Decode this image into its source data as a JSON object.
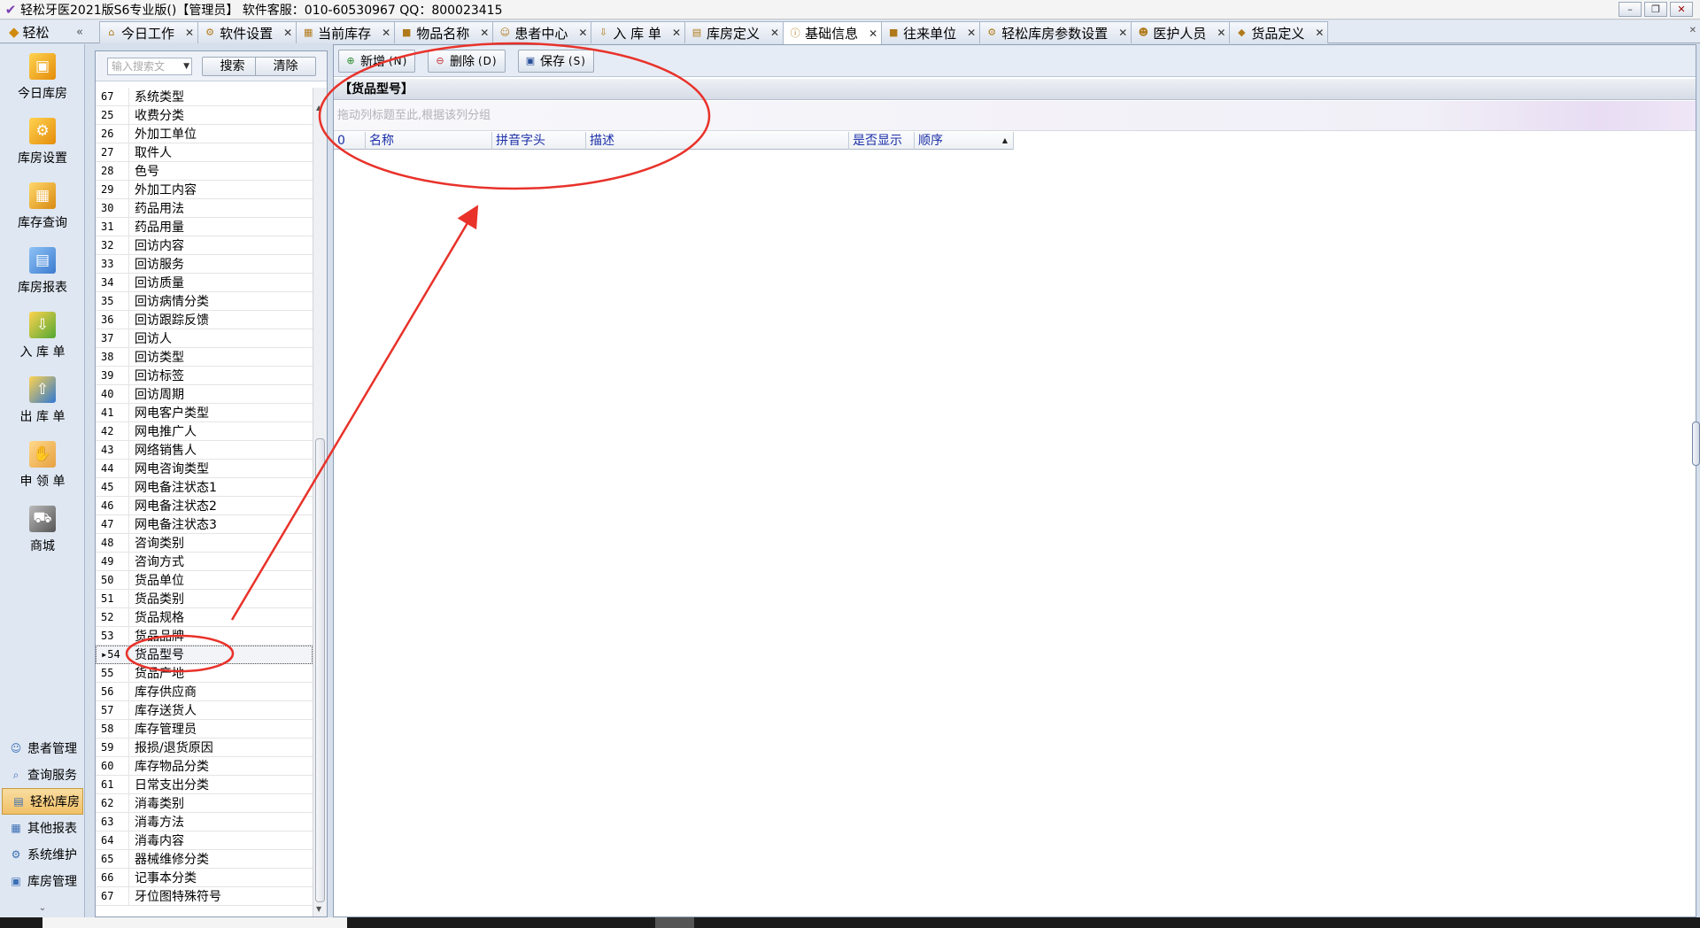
{
  "window": {
    "title": "轻松牙医2021版S6专业版()【管理员】    软件客服：010-60530967 QQ：800023415",
    "buttons": {
      "minimize": "–",
      "restore": "❐",
      "close": "✕"
    }
  },
  "nav_header": {
    "label": "轻松",
    "collapse": "«"
  },
  "tabs": [
    {
      "label": "今日工作",
      "icon": "home-icon"
    },
    {
      "label": "软件设置",
      "icon": "gear-icon"
    },
    {
      "label": "当前库存",
      "icon": "table-icon"
    },
    {
      "label": "物品名称",
      "icon": "box-icon"
    },
    {
      "label": "患者中心",
      "icon": "user-icon"
    },
    {
      "label": "入 库 单",
      "icon": "in-stock-icon"
    },
    {
      "label": "库房定义",
      "icon": "warehouse-icon"
    },
    {
      "label": "基础信息",
      "icon": "info-icon",
      "active": true
    },
    {
      "label": "往来单位",
      "icon": "box-icon"
    },
    {
      "label": "轻松库房参数设置",
      "icon": "gear-icon"
    },
    {
      "label": "医护人员",
      "icon": "staff-icon"
    },
    {
      "label": "货品定义",
      "icon": "tag-icon"
    }
  ],
  "tab_close": "✕",
  "left_nav": {
    "big_items": [
      {
        "label": "今日库房",
        "icon": "warehouse-icon"
      },
      {
        "label": "库房设置",
        "icon": "warehouse-settings-icon"
      },
      {
        "label": "库存查询",
        "icon": "stock-query-icon"
      },
      {
        "label": "库房报表",
        "icon": "report-icon"
      },
      {
        "label": "入 库 单",
        "icon": "stock-in-icon"
      },
      {
        "label": "出 库 单",
        "icon": "stock-out-icon"
      },
      {
        "label": "申 领 单",
        "icon": "request-hand-icon"
      },
      {
        "label": "商城",
        "icon": "cart-icon"
      }
    ],
    "small_items": [
      {
        "label": "患者管理",
        "icon": "patients-icon"
      },
      {
        "label": "查询服务",
        "icon": "query-icon"
      },
      {
        "label": "轻松库房",
        "icon": "warehouse-icon",
        "active": true
      },
      {
        "label": "其他报表",
        "icon": "report-icon"
      },
      {
        "label": "系统维护",
        "icon": "maintenance-icon"
      },
      {
        "label": "库房管理",
        "icon": "warehouse-manage-icon"
      }
    ],
    "more": "⌄"
  },
  "list_panel": {
    "search_placeholder": "输入搜索文",
    "search_button": "搜索",
    "clear_button": "清除",
    "selected_index": 54,
    "rows": [
      {
        "num": "67",
        "name": "系统类型"
      },
      {
        "num": "25",
        "name": "收费分类"
      },
      {
        "num": "26",
        "name": "外加工单位"
      },
      {
        "num": "27",
        "name": "取件人"
      },
      {
        "num": "28",
        "name": "色号"
      },
      {
        "num": "29",
        "name": "外加工内容"
      },
      {
        "num": "30",
        "name": "药品用法"
      },
      {
        "num": "31",
        "name": "药品用量"
      },
      {
        "num": "32",
        "name": "回访内容"
      },
      {
        "num": "33",
        "name": "回访服务"
      },
      {
        "num": "34",
        "name": "回访质量"
      },
      {
        "num": "35",
        "name": "回访病情分类"
      },
      {
        "num": "36",
        "name": "回访跟踪反馈"
      },
      {
        "num": "37",
        "name": "回访人"
      },
      {
        "num": "38",
        "name": "回访类型"
      },
      {
        "num": "39",
        "name": "回访标签"
      },
      {
        "num": "40",
        "name": "回访周期"
      },
      {
        "num": "41",
        "name": "网电客户类型"
      },
      {
        "num": "42",
        "name": "网电推广人"
      },
      {
        "num": "43",
        "name": "网络销售人"
      },
      {
        "num": "44",
        "name": "网电咨询类型"
      },
      {
        "num": "45",
        "name": "网电备注状态1"
      },
      {
        "num": "46",
        "name": "网电备注状态2"
      },
      {
        "num": "47",
        "name": "网电备注状态3"
      },
      {
        "num": "48",
        "name": "咨询类别"
      },
      {
        "num": "49",
        "name": "咨询方式"
      },
      {
        "num": "50",
        "name": "货品单位"
      },
      {
        "num": "51",
        "name": "货品类别"
      },
      {
        "num": "52",
        "name": "货品规格"
      },
      {
        "num": "53",
        "name": "货品品牌"
      },
      {
        "num": "54",
        "name": "货品型号"
      },
      {
        "num": "55",
        "name": "货品产地"
      },
      {
        "num": "56",
        "name": "库存供应商"
      },
      {
        "num": "57",
        "name": "库存送货人"
      },
      {
        "num": "58",
        "name": "库存管理员"
      },
      {
        "num": "59",
        "name": "报损/退货原因"
      },
      {
        "num": "60",
        "name": "库存物品分类"
      },
      {
        "num": "61",
        "name": "日常支出分类"
      },
      {
        "num": "62",
        "name": "消毒类别"
      },
      {
        "num": "63",
        "name": "消毒方法"
      },
      {
        "num": "64",
        "name": "消毒内容"
      },
      {
        "num": "65",
        "name": "器械维修分类"
      },
      {
        "num": "66",
        "name": "记事本分类"
      },
      {
        "num": "67",
        "name": "牙位图特殊符号"
      }
    ]
  },
  "toolbar": {
    "add_label": "新增",
    "add_shortcut": "(N)",
    "delete_label": "删除",
    "delete_shortcut": "(D)",
    "save_label": "保存",
    "save_shortcut": "(S)"
  },
  "detail": {
    "panel_title": "【货品型号】",
    "group_hint": "拖动列标题至此,根据该列分组",
    "columns": [
      "0",
      "名称",
      "拼音字头",
      "描述",
      "是否显示",
      "顺序"
    ],
    "sort_column": "顺序"
  },
  "annotation_color": "#e8322a"
}
